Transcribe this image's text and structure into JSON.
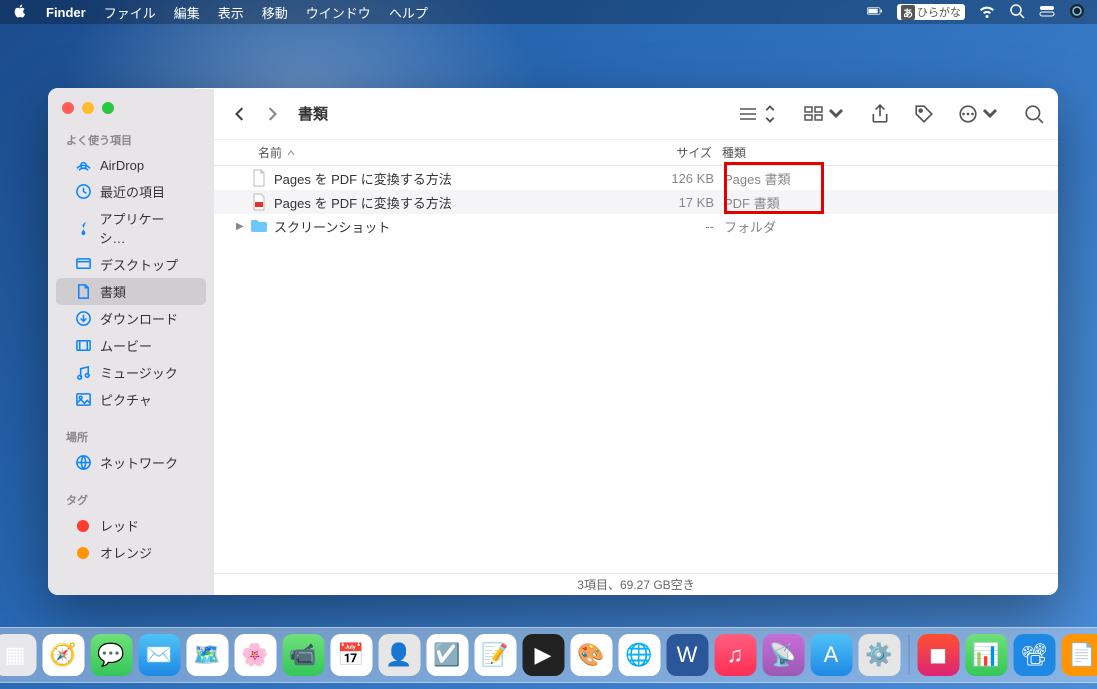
{
  "menubar": {
    "app": "Finder",
    "items": [
      "ファイル",
      "編集",
      "表示",
      "移動",
      "ウインドウ",
      "ヘルプ"
    ],
    "ime_label": "ひらがな",
    "ime_badge": "あ"
  },
  "sidebar": {
    "section_favorites": "よく使う項目",
    "favorites": [
      {
        "icon": "airdrop",
        "label": "AirDrop"
      },
      {
        "icon": "clock",
        "label": "最近の項目"
      },
      {
        "icon": "apps",
        "label": "アプリケーシ…"
      },
      {
        "icon": "desktop",
        "label": "デスクトップ"
      },
      {
        "icon": "doc",
        "label": "書類",
        "selected": true
      },
      {
        "icon": "download",
        "label": "ダウンロード"
      },
      {
        "icon": "movie",
        "label": "ムービー"
      },
      {
        "icon": "music",
        "label": "ミュージック"
      },
      {
        "icon": "picture",
        "label": "ピクチャ"
      }
    ],
    "section_locations": "場所",
    "locations": [
      {
        "icon": "network",
        "label": "ネットワーク"
      }
    ],
    "section_tags": "タグ",
    "tags": [
      {
        "color": "#ff3b30",
        "label": "レッド"
      },
      {
        "color": "#ff9500",
        "label": "オレンジ"
      }
    ]
  },
  "window": {
    "title": "書類",
    "columns": {
      "name": "名前",
      "size": "サイズ",
      "kind": "種類"
    },
    "rows": [
      {
        "icon": "page",
        "name": "Pages を PDF に変換する方法",
        "size": "126 KB",
        "kind": "Pages 書類"
      },
      {
        "icon": "pdf",
        "name": "Pages を PDF に変換する方法",
        "size": "17 KB",
        "kind": "PDF 書類"
      },
      {
        "icon": "folder",
        "name": "スクリーンショット",
        "size": "--",
        "kind": "フォルダ",
        "expandable": true
      }
    ],
    "status": "3項目、69.27 GB空き"
  },
  "dock": {
    "items": [
      {
        "name": "finder",
        "bg": "linear-gradient(#6ec6ff,#1e88e5)",
        "glyph": "🙂"
      },
      {
        "name": "launchpad",
        "bg": "#e8e8ec",
        "glyph": "▦"
      },
      {
        "name": "safari",
        "bg": "#fff",
        "glyph": "🧭"
      },
      {
        "name": "messages",
        "bg": "linear-gradient(#6fe07a,#34c759)",
        "glyph": "💬"
      },
      {
        "name": "mail",
        "bg": "linear-gradient(#4fc3f7,#1e88e5)",
        "glyph": "✉️"
      },
      {
        "name": "maps",
        "bg": "#fff",
        "glyph": "🗺️"
      },
      {
        "name": "photos",
        "bg": "#fff",
        "glyph": "🌸"
      },
      {
        "name": "facetime",
        "bg": "linear-gradient(#6fe07a,#34c759)",
        "glyph": "📹"
      },
      {
        "name": "calendar",
        "bg": "#fff",
        "glyph": "📅"
      },
      {
        "name": "contacts",
        "bg": "#e6e6e6",
        "glyph": "👤"
      },
      {
        "name": "reminders",
        "bg": "#fff",
        "glyph": "☑️"
      },
      {
        "name": "notes",
        "bg": "#fff",
        "glyph": "📝"
      },
      {
        "name": "tv",
        "bg": "#222",
        "glyph": "▶︎"
      },
      {
        "name": "creative",
        "bg": "#fff",
        "glyph": "🎨"
      },
      {
        "name": "chrome",
        "bg": "#fff",
        "glyph": "🌐"
      },
      {
        "name": "word",
        "bg": "#2b579a",
        "glyph": "W"
      },
      {
        "name": "music",
        "bg": "linear-gradient(#ff5e7e,#ff2d55)",
        "glyph": "♫"
      },
      {
        "name": "podcasts",
        "bg": "linear-gradient(#c86dd7,#9b59b6)",
        "glyph": "📡"
      },
      {
        "name": "appstore",
        "bg": "linear-gradient(#4fc3f7,#1e88e5)",
        "glyph": "A"
      },
      {
        "name": "preferences",
        "bg": "#e6e6e6",
        "glyph": "⚙️"
      }
    ],
    "right": [
      {
        "name": "shortcuts",
        "bg": "linear-gradient(#ff512f,#dd2476)",
        "glyph": "◼︎"
      },
      {
        "name": "numbers",
        "bg": "linear-gradient(#6fe07a,#34c759)",
        "glyph": "📊"
      },
      {
        "name": "keynote",
        "bg": "#1e88e5",
        "glyph": "📽"
      },
      {
        "name": "pages",
        "bg": "#ff9500",
        "glyph": "📄"
      },
      {
        "name": "trash",
        "bg": "transparent",
        "glyph": "🗑️"
      }
    ]
  }
}
